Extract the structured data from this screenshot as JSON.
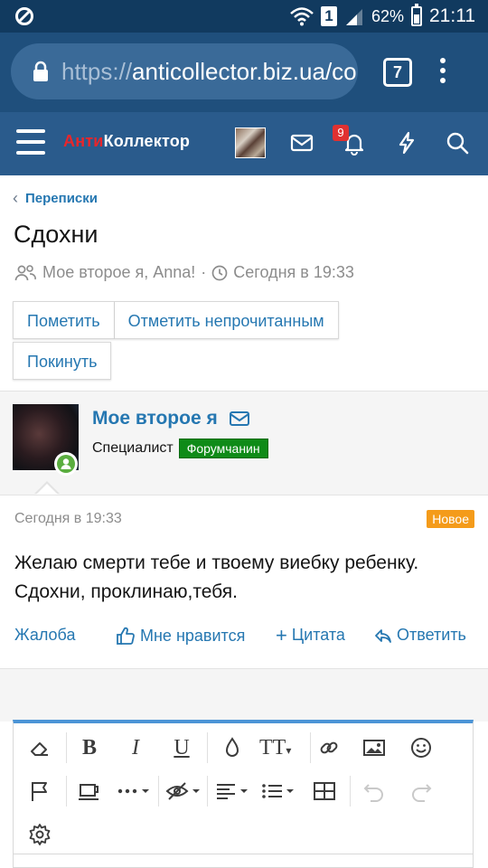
{
  "status_bar": {
    "signal_badge": "1",
    "battery": "62%",
    "battery_level": 0.62,
    "time": "21:11"
  },
  "browser": {
    "url_protocol": "https://",
    "url_host": "anticollector.biz.ua/co",
    "tab_count": "7"
  },
  "site": {
    "logo_part1": "Анти",
    "logo_part2": "Коллектор",
    "notifications_count": "9",
    "nav_icons": [
      "menu-icon",
      "avatar",
      "envelope-icon",
      "bell-icon",
      "lightning-icon",
      "search-icon"
    ]
  },
  "breadcrumb": {
    "label": "Переписки"
  },
  "page": {
    "title": "Сдохни",
    "participants": "Мое второе я, Anna!",
    "separator": "·",
    "time": "Сегодня в 19:33"
  },
  "buttons": {
    "mark": "Пометить",
    "mark_unread": "Отметить непрочитанным",
    "leave": "Покинуть"
  },
  "message": {
    "username": "Мое второе я",
    "role": "Специалист",
    "user_title": "Форумчанин",
    "date": "Сегодня в 19:33",
    "new_badge": "Новое",
    "text": "Желаю смерти тебе и твоему виебку ребенку. Сдохни, проклинаю,тебя.",
    "actions": {
      "report": "Жалоба",
      "like": "Мне нравится",
      "quote": "Цитата",
      "reply": "Ответить"
    }
  },
  "editor": {
    "toolbar_icons": [
      "eraser-icon",
      "bold-icon",
      "italic-icon",
      "underline-icon",
      "color-icon",
      "text-size-icon",
      "link-icon",
      "image-icon",
      "smiley-icon",
      "flag-icon",
      "cup-icon",
      "more-icon",
      "hide-icon",
      "align-icon",
      "list-icon",
      "table-icon",
      "undo-icon",
      "redo-icon",
      "gear-icon"
    ],
    "bold": "B",
    "italic": "I",
    "underline": "U",
    "text_size": "TT"
  },
  "colors": {
    "accent": "#2577b1",
    "header": "#2a5b8c",
    "status_bar": "#113a5f",
    "new_badge": "#f49b1a",
    "user_title_bg": "#0f8b18",
    "logo_red": "#e8262b"
  }
}
